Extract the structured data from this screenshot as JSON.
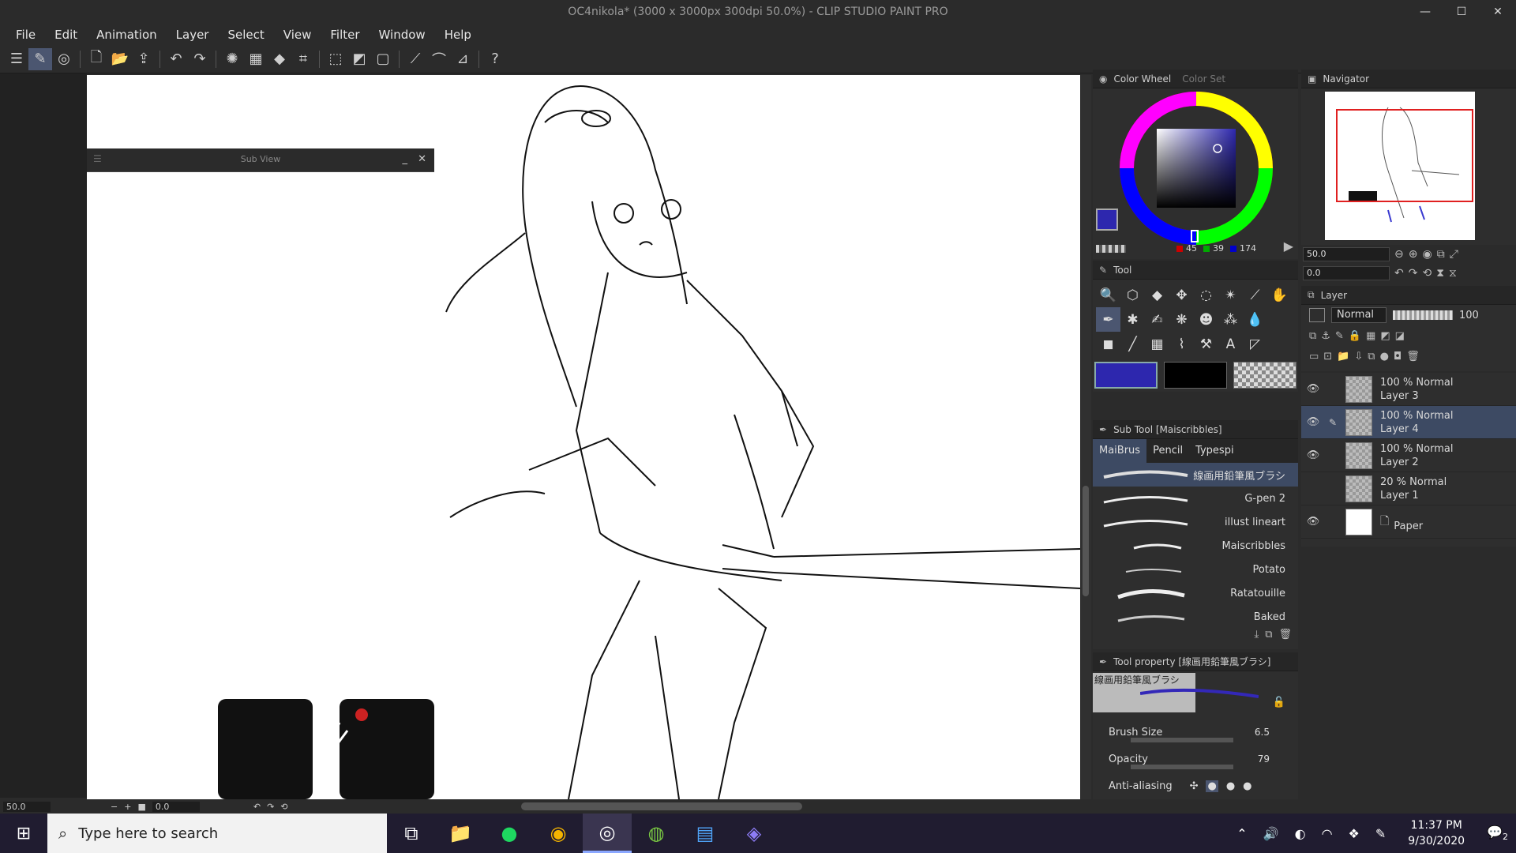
{
  "window": {
    "title": "OC4nikola* (3000 x 3000px 300dpi 50.0%)  - CLIP STUDIO PAINT PRO",
    "controls": [
      "—",
      "☐",
      "✕"
    ]
  },
  "menu": [
    "File",
    "Edit",
    "Animation",
    "Layer",
    "Select",
    "View",
    "Filter",
    "Window",
    "Help"
  ],
  "subview": {
    "title": "Sub View"
  },
  "statusbar": {
    "zoom": "50.0",
    "angle": "0.0"
  },
  "color_panel": {
    "tab_active": "Color Wheel",
    "tab_inactive": "Color Set",
    "main_color": "#2d27ae",
    "r": "45",
    "g": "39",
    "b": "174"
  },
  "navigator": {
    "title": "Navigator",
    "zoom": "50.0",
    "angle": "0.0"
  },
  "tool_panel": {
    "title": "Tool"
  },
  "swatches": {
    "main": "#2d27ae",
    "sub": "#000000"
  },
  "subtool": {
    "title": "Sub Tool [Maiscribbles]",
    "tabs": [
      "MaiBrus",
      "Pencil",
      "Typespi"
    ],
    "brushes": [
      "線画用鉛筆風ブラシ",
      "G-pen 2",
      "illust lineart",
      "Maiscribbles",
      "Potato",
      "Ratatouille",
      "Baked"
    ]
  },
  "toolprop": {
    "title": "Tool property [線画用鉛筆風ブラシ]",
    "preview_label": "線画用鉛筆風ブラシ",
    "brush_size_label": "Brush Size",
    "brush_size": "6.5",
    "opacity_label": "Opacity",
    "opacity": "79",
    "aa_label": "Anti-aliasing"
  },
  "layer_panel": {
    "title": "Layer",
    "blend_mode": "Normal",
    "opacity": "100",
    "layers": [
      {
        "mode": "100 % Normal",
        "name": "Layer 3"
      },
      {
        "mode": "100 % Normal",
        "name": "Layer 4"
      },
      {
        "mode": "100 % Normal",
        "name": "Layer 2"
      },
      {
        "mode": "20 % Normal",
        "name": "Layer 1"
      },
      {
        "mode": "",
        "name": "Paper"
      }
    ]
  },
  "taskbar": {
    "search_placeholder": "Type here to search",
    "time": "11:37 PM",
    "date": "9/30/2020",
    "notifications": "2"
  }
}
